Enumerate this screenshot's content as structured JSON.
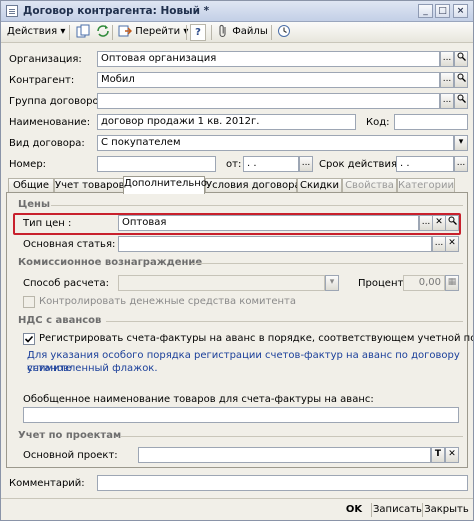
{
  "window": {
    "title": "Договор контрагента: Новый *",
    "btn_min": "_",
    "btn_max": "□",
    "btn_close": "×"
  },
  "toolbar": {
    "actions": "Действия",
    "goto": "Перейти",
    "help": "?",
    "files": "Файлы"
  },
  "form": {
    "org_label": "Организация:",
    "org_value": "Оптовая организация",
    "contr_label": "Контрагент:",
    "contr_value": "Мобил",
    "group_label": "Группа договоров:",
    "group_value": "",
    "name_label": "Наименование:",
    "name_value": "договор продажи 1 кв. 2012г.",
    "code_label": "Код:",
    "code_value": "",
    "kind_label": "Вид договора:",
    "kind_value": "С покупателем",
    "num_label": "Номер:",
    "num_value": "",
    "from_label": "от:",
    "from_value": " .  .",
    "term_label": "Срок действия:",
    "term_value": " .  ."
  },
  "tabs": [
    "Общие",
    "Учет товаров",
    "Дополнительно",
    "Условия договора",
    "Скидки",
    "Свойства",
    "Категории"
  ],
  "prices": {
    "section": "Цены",
    "type_label": "Тип цен :",
    "type_value": "Оптовая",
    "article_label": "Основная статья:",
    "article_value": ""
  },
  "commission": {
    "section": "Комиссионное вознаграждение",
    "method_label": "Способ расчета:",
    "method_value": "",
    "percent_label": "Процент:",
    "percent_value": "0,00",
    "control_label": "Контролировать денежные средства комитента"
  },
  "vat": {
    "section": "НДС с авансов",
    "register_label": "Регистрировать счета-фактуры на аванс в порядке, соответствующем учетной политике",
    "note_line1": "Для указания особого порядка регистрации счетов-фактур на аванс по договору снимите",
    "note_line2": "установленный флажок.",
    "goods_label": "Обобщенное наименование товаров для счета-фактуры на аванс:",
    "goods_value": ""
  },
  "projects": {
    "section": "Учет по проектам",
    "main_label": "Основной проект:",
    "main_value": ""
  },
  "comment": {
    "label": "Комментарий:",
    "value": ""
  },
  "buttons": {
    "ok": "OK",
    "save": "Записать",
    "close": "Закрыть"
  }
}
